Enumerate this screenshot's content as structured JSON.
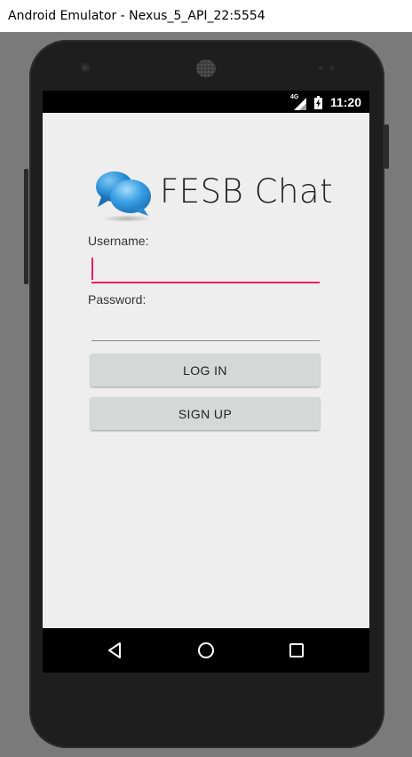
{
  "window": {
    "title": "Android Emulator - Nexus_5_API_22:5554"
  },
  "status_bar": {
    "network": "4G",
    "time": "11:20",
    "icons": [
      "signal-icon",
      "battery-charging-icon"
    ]
  },
  "app": {
    "title": "FESB Chat",
    "logo_icon": "chat-bubbles-icon",
    "username": {
      "label": "Username:",
      "value": ""
    },
    "password": {
      "label": "Password:",
      "value": ""
    },
    "login_button": "LOG IN",
    "signup_button": "SIGN UP",
    "colors": {
      "focus_accent": "#e91e63",
      "button_bg": "#d6d7d7",
      "screen_bg": "#eeeeee",
      "logo_blue": "#1e88d4"
    }
  },
  "nav_bar": {
    "icons": [
      "back-icon",
      "home-icon",
      "recents-icon"
    ]
  }
}
